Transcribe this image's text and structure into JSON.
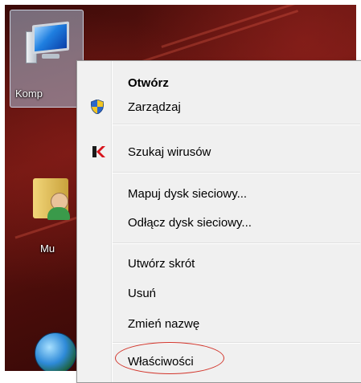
{
  "desktop": {
    "icons": [
      {
        "label": "Komp",
        "icon": "computer-icon"
      },
      {
        "label": "Mu",
        "icon": "user-folder-icon"
      },
      {
        "label": "",
        "icon": "network-globe-icon"
      }
    ]
  },
  "context_menu": {
    "items": [
      {
        "label": "Otwórz",
        "bold": true
      },
      {
        "label": "Zarządzaj",
        "icon": "shield-icon"
      },
      {
        "label": "Szukaj wirusów",
        "icon": "kaspersky-icon"
      },
      {
        "label": "Mapuj dysk sieciowy..."
      },
      {
        "label": "Odłącz dysk sieciowy..."
      },
      {
        "label": "Utwórz skrót"
      },
      {
        "label": "Usuń"
      },
      {
        "label": "Zmień nazwę"
      },
      {
        "label": "Właściwości",
        "highlighted": true
      }
    ]
  },
  "colors": {
    "highlight_ring": "#d2342a",
    "menu_background": "#f0f0f0"
  }
}
